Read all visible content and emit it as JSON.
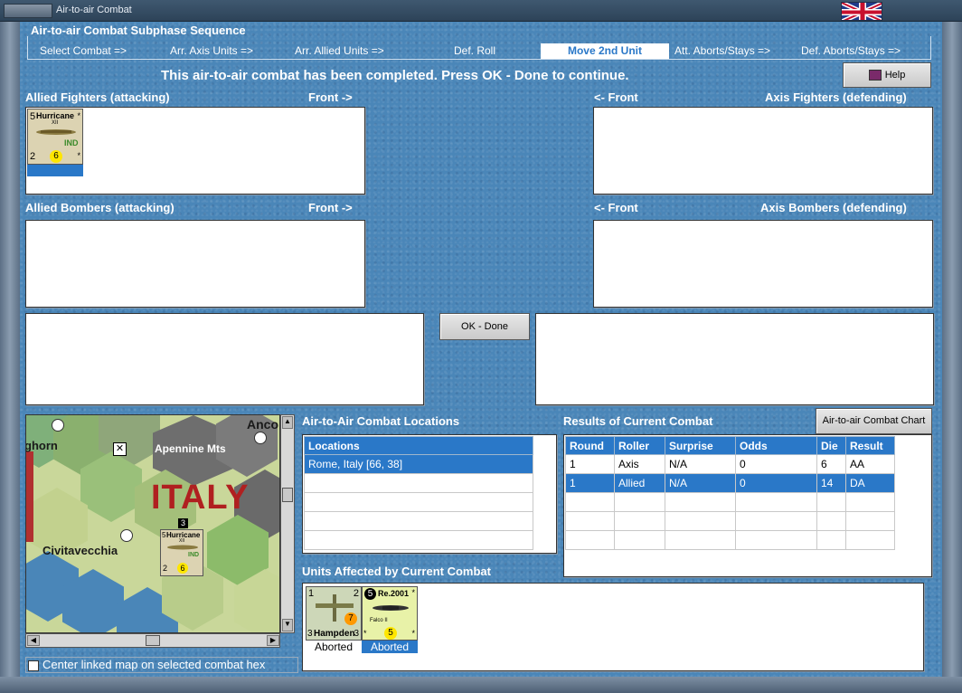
{
  "window": {
    "title": "Air-to-air Combat"
  },
  "sequence": {
    "title": "Air-to-air Combat Subphase Sequence",
    "steps": [
      "Select Combat =>",
      "Arr. Axis Units =>",
      "Arr. Allied Units =>",
      "Def. Roll",
      "Move 2nd Unit",
      "Att. Aborts/Stays =>",
      "Def. Aborts/Stays =>"
    ],
    "active_index": 4
  },
  "message": "This air-to-air combat has been completed.  Press OK - Done to continue.",
  "help_label": "Help",
  "panels": {
    "allied_fighters": "Allied Fighters (attacking)",
    "axis_fighters": "Axis Fighters (defending)",
    "allied_bombers": "Allied Bombers (attacking)",
    "axis_bombers": "Axis Bombers (defending)",
    "front_right": "Front ->",
    "front_left": "<- Front"
  },
  "allied_fighter_unit": {
    "name": "Hurricane",
    "sub": "XII",
    "nation": "IND",
    "left_top": "5",
    "air2air": "2",
    "range": "6",
    "star": "*"
  },
  "ok_label": "OK - Done",
  "map": {
    "labels": [
      "ghorn",
      "Apennine Mts",
      "Anco",
      "ITALY",
      "Civitavecchia"
    ],
    "stack_count": "3",
    "unit": {
      "name": "Hurricane",
      "sub": "XII",
      "nation": "IND",
      "left_top": "5",
      "air2air": "2",
      "range": "6"
    }
  },
  "locations": {
    "title": "Air-to-Air Combat Locations",
    "header": "Locations",
    "rows": [
      "Rome, Italy [66, 38]"
    ]
  },
  "results": {
    "title": "Results of Current Combat",
    "chart_button": "Air-to-air Combat Chart",
    "columns": [
      "Round",
      "Roller",
      "Surprise",
      "Odds",
      "Die",
      "Result"
    ],
    "rows": [
      [
        "1",
        "Axis",
        "N/A",
        "0",
        "6",
        "AA"
      ],
      [
        "1",
        "Allied",
        "N/A",
        "0",
        "14",
        "DA"
      ]
    ],
    "selected_row": 1
  },
  "affected": {
    "title": "Units Affected by Current Combat",
    "units": [
      {
        "name": "Hampden",
        "left_top": "1",
        "right_top": "2",
        "bottom_left": "3",
        "bottom_right": "3",
        "value": "7",
        "status": "Aborted"
      },
      {
        "name": "Re.2001",
        "sub": "Falco II",
        "left_top": "5",
        "value": "5",
        "status": "Aborted",
        "star": "*"
      }
    ]
  },
  "center_checkbox": "Center linked map on selected combat hex"
}
